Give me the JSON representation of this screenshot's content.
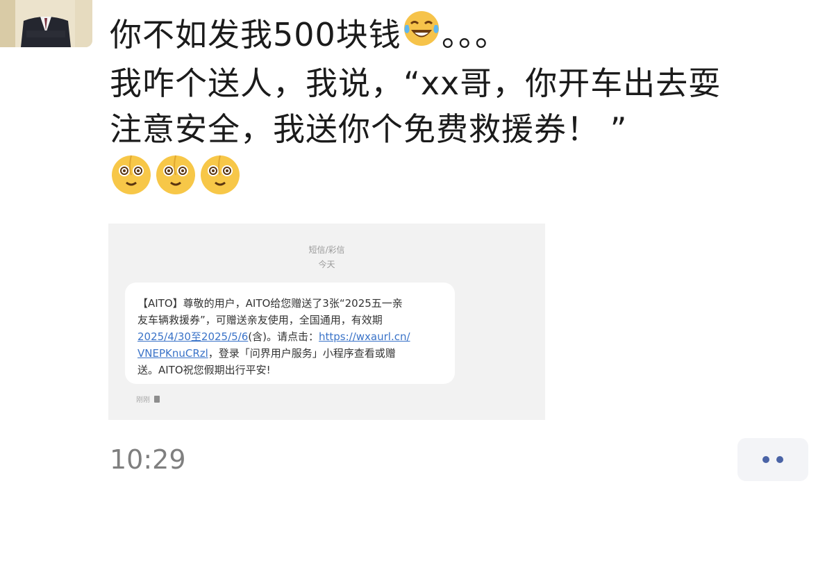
{
  "post": {
    "line1": "你不如发我500块钱",
    "line1_tail": "。。。",
    "line2": "我咋个送人，我说，“xx哥，你开车出去耍",
    "line3": "注意安全，我送你个免费救援券！ ”",
    "line1_emoji": "face-with-tears-of-joy-icon",
    "row_emojis": [
      "dizzy-face-icon",
      "dizzy-face-icon",
      "dizzy-face-icon"
    ]
  },
  "sms": {
    "channel": "短信/彩信",
    "date": "今天",
    "lines": {
      "l1": "【AITO】尊敬的用户，AITO给您赠送了3张“2025五一亲",
      "l2": "友车辆救援券”，可赠送亲友使用，全国通用，有效期",
      "l3_link": "2025/4/30至2025/5/6",
      "l3_mid": "(含)。请点击：",
      "l3_url": "https://wxaurl.cn/",
      "l4_url": "VNEPKnuCRzl",
      "l4_rest": "，登录「问界用户服务」小程序查看或赠",
      "l5": "送。AITO祝您假期出行平安!"
    },
    "foot_label": "刚刚",
    "foot_icon": "sim-card-icon"
  },
  "timestamp": "10:29",
  "more_button_icon": "more-dots-icon",
  "colors": {
    "link": "#3a73c8",
    "dots": "#4a63a6",
    "text": "#1b1b1b"
  }
}
